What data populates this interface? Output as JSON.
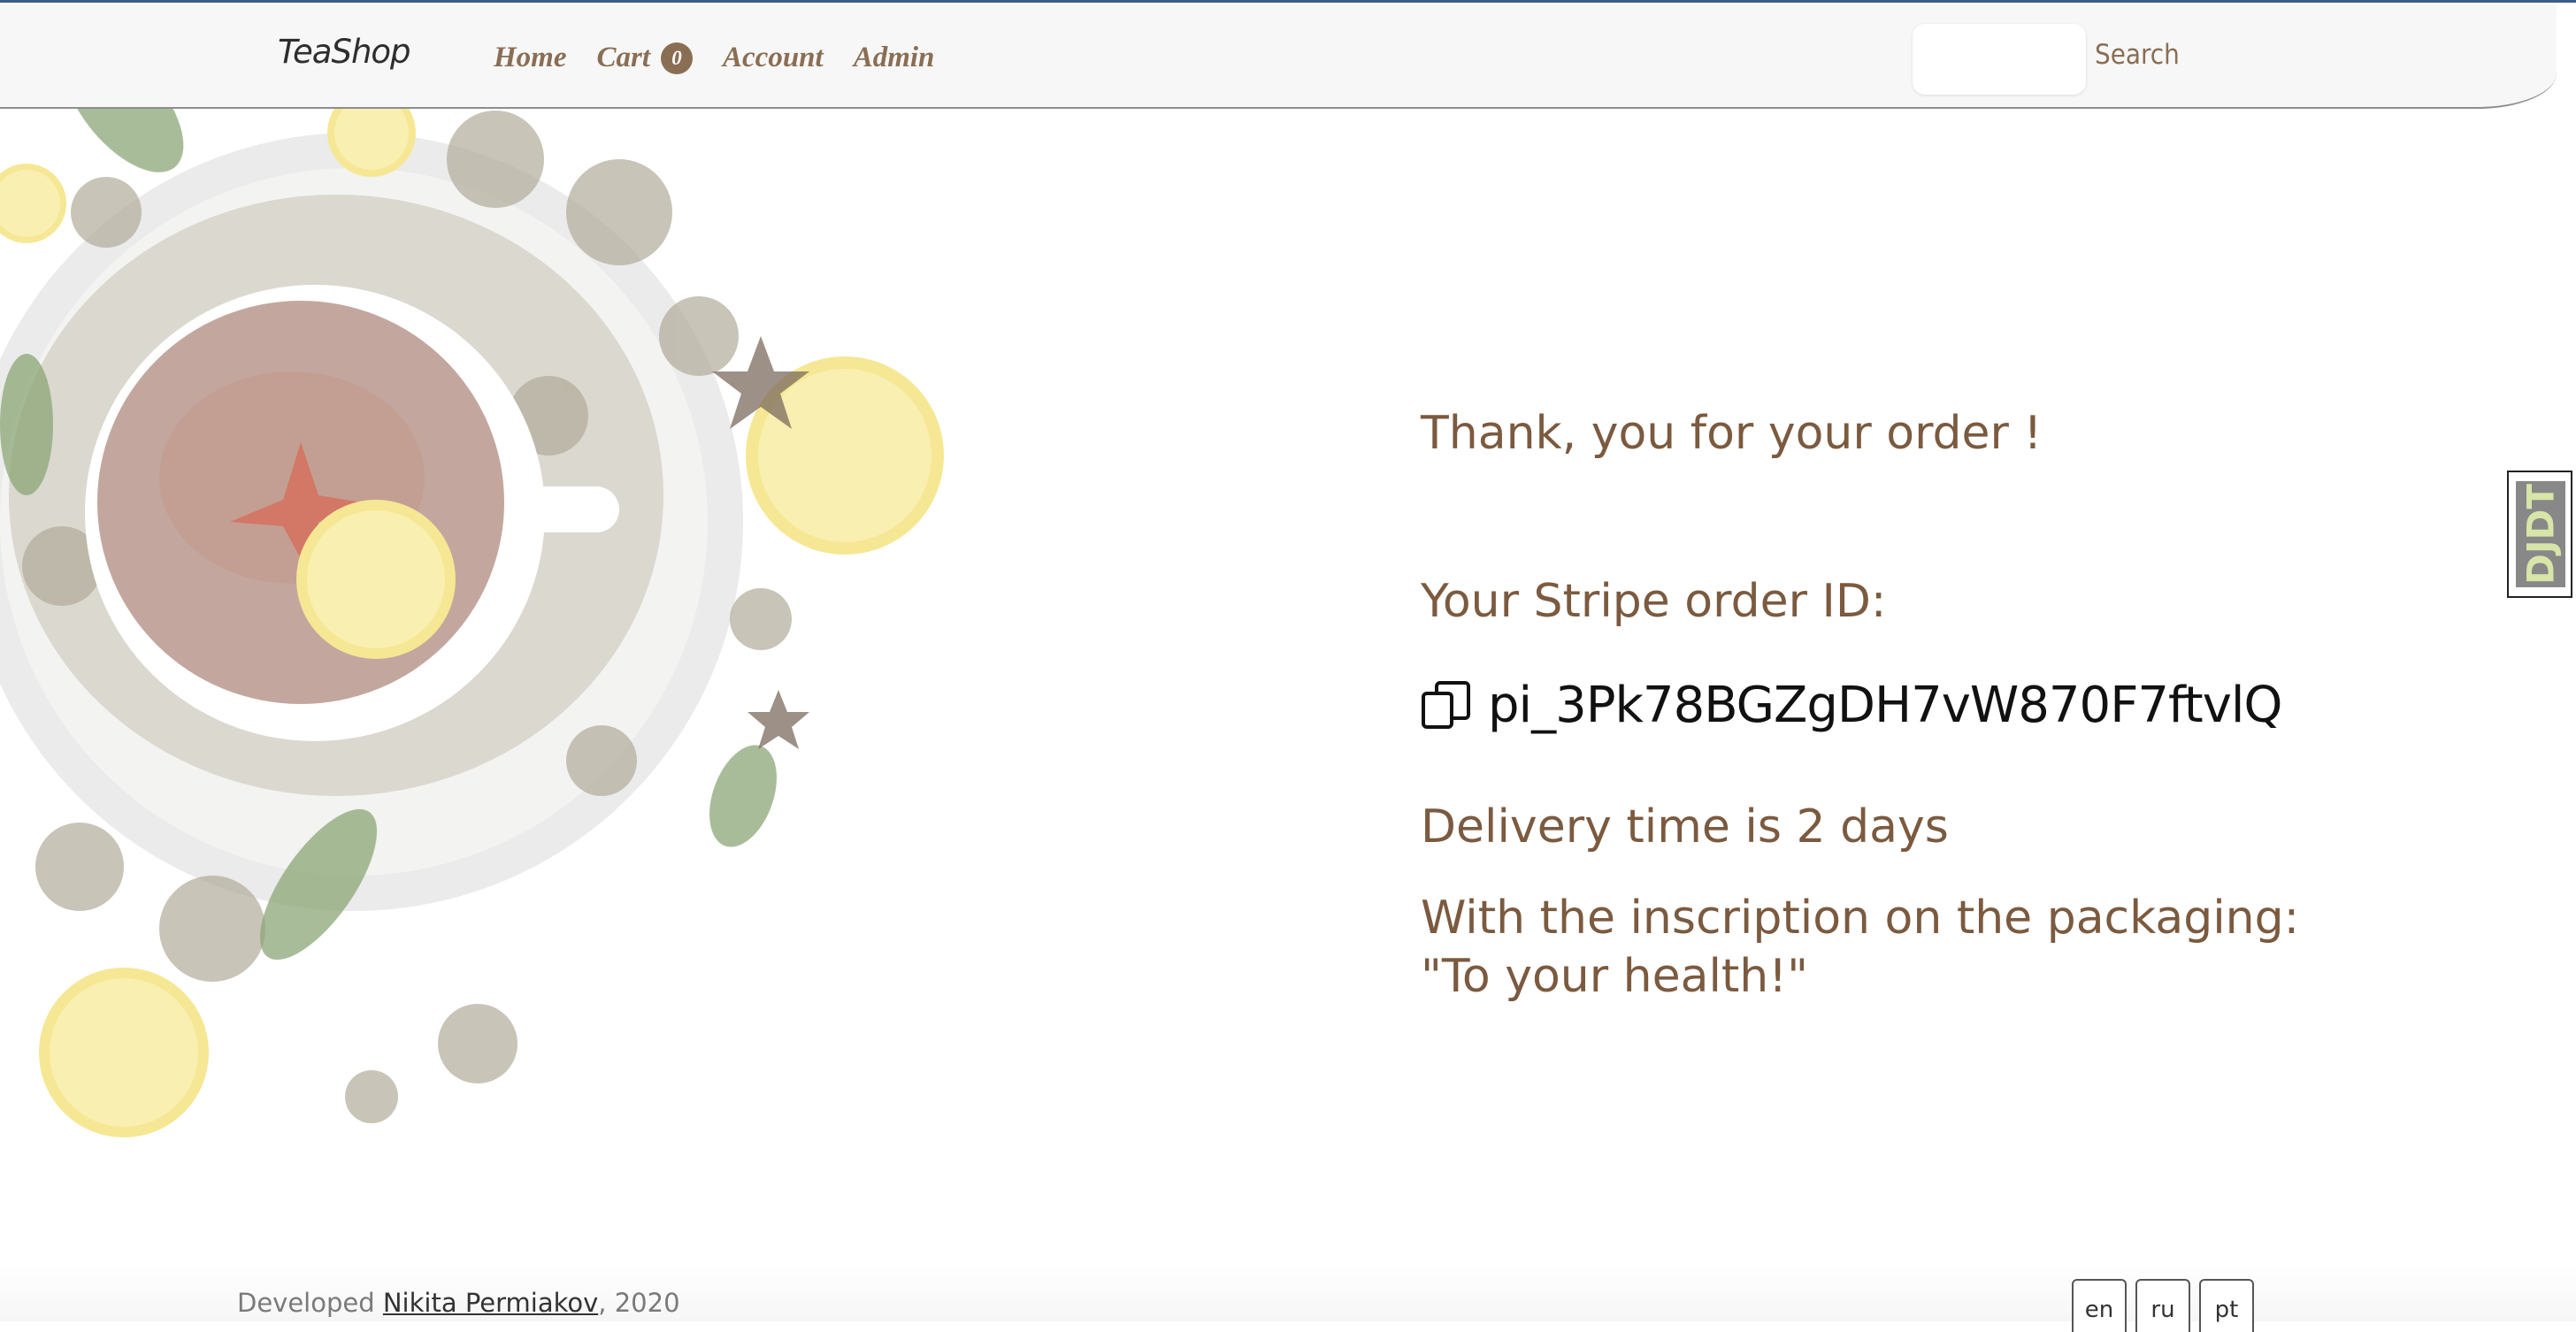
{
  "header": {
    "logo": "TeaShop",
    "nav": [
      {
        "label": "Home"
      },
      {
        "label": "Cart",
        "badge": "0"
      },
      {
        "label": "Account"
      },
      {
        "label": "Admin"
      }
    ],
    "search_placeholder": "",
    "search_button": "Search"
  },
  "main": {
    "thanks": "Thank, you for your order !",
    "stripe_label": "Your Stripe order ID:",
    "order_id": "pi_3Pk78BGZgDH7vW870F7ftvlQ",
    "delivery": "Delivery time is 2 days",
    "inscription": "With the inscription on the packaging: \"To your health!\""
  },
  "djdt": {
    "label": "DJDT"
  },
  "footer": {
    "developed": "Developed",
    "author": "Nikita Permiakov",
    "year": ", 2020",
    "languages": [
      "en",
      "ru",
      "pt"
    ]
  },
  "colors": {
    "accent_brown": "#7b5a3f",
    "nav_brown": "#8a6e54",
    "top_border": "#3b5d8a"
  }
}
